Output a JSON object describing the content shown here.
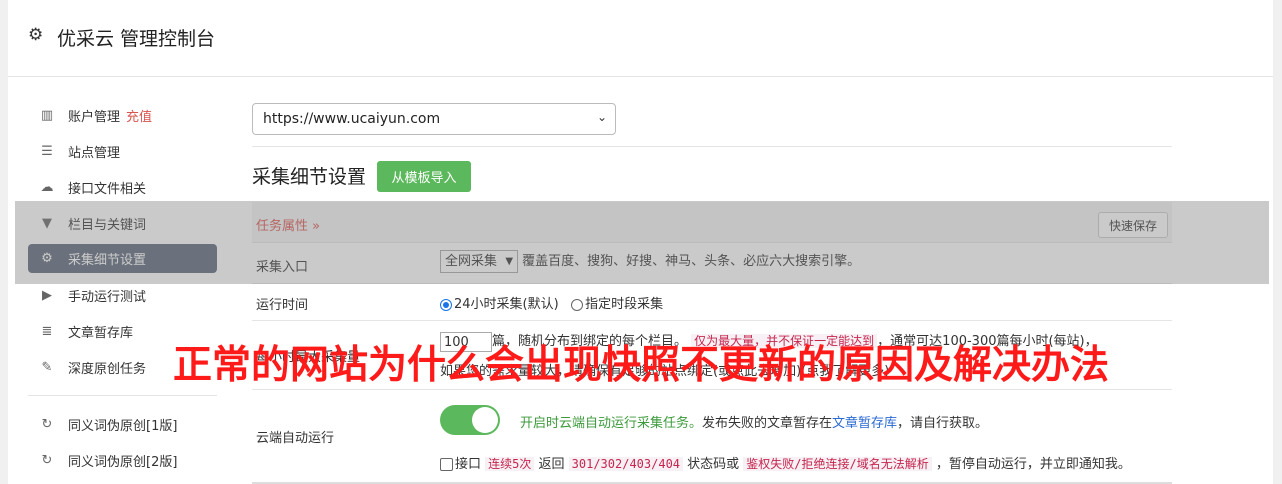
{
  "header": {
    "icon": "gear-icon",
    "title": "优采云 管理控制台"
  },
  "sidebar": {
    "items": [
      {
        "icon": "bar-chart-icon",
        "glyph": "▥",
        "label": "账户管理",
        "extra": "充值"
      },
      {
        "icon": "server-icon",
        "glyph": "☰",
        "label": "站点管理"
      },
      {
        "icon": "cloud-upload-icon",
        "glyph": "☁",
        "label": "接口文件相关"
      },
      {
        "icon": "filter-icon",
        "glyph": "▼",
        "label": "栏目与关键词"
      },
      {
        "icon": "cogs-icon",
        "glyph": "⚙",
        "label": "采集细节设置"
      },
      {
        "icon": "play-circle-icon",
        "glyph": "▶",
        "label": "手动运行测试"
      },
      {
        "icon": "database-icon",
        "glyph": "≣",
        "label": "文章暂存库"
      },
      {
        "icon": "edit-icon",
        "glyph": "✎",
        "label": "深度原创任务"
      },
      {
        "icon": "refresh-icon",
        "glyph": "↻",
        "label": "同义词伪原创[1版]"
      },
      {
        "icon": "refresh-icon",
        "glyph": "↻",
        "label": "同义词伪原创[2版]"
      }
    ],
    "active_item": "采集细节设置"
  },
  "main": {
    "site_select": {
      "value": "https://www.ucaiyun.com"
    },
    "section_title": "采集细节设置",
    "import_button": "从模板导入",
    "task_header": {
      "label": "任务属性 »",
      "save_button": "快速保存"
    },
    "rows": {
      "entry": {
        "label": "采集入口",
        "select_value": "全网采集",
        "desc": "覆盖百度、搜狗、好搜、神马、头条、必应六大搜索引擎。"
      },
      "runtime": {
        "label": "运行时间",
        "opt1": "24小时采集(默认)",
        "opt2": "指定时段采集"
      },
      "volume": {
        "label": "每小时最大采集量",
        "input_value": "100",
        "t1": "篇，随机分布到绑定的每个栏目。",
        "highlight": "仅为最大量，并不保证一定能达到",
        "t2": "，通常可达100-300篇每小时(每站)，",
        "line2": "如果您的需求量较大，请确保有足够的站点绑定(或点此去增加)(点我了解更多)",
        "line2_link": "点我了解更多"
      },
      "cloud": {
        "label": "云端自动运行",
        "toggle_text": "开启时云端自动运行采集任务。",
        "t2": "发布失败的文章暂存在",
        "link": "文章暂存库",
        "t3": "，请自行获取。",
        "chk1": "接口",
        "code1": "连续5次",
        "chk2": " 返回 ",
        "code2": "301/302/403/404",
        "chk3": " 状态码或 ",
        "code3": "鉴权失败/拒绝连接/域名无法解析",
        "chk4": " ，暂停自动运行，并立即通知我。"
      }
    }
  },
  "overlay_banner": "正常的网站为什么会出现快照不更新的原因及解决办法",
  "colors": {
    "accent_green": "#5cb85c",
    "active_nav": "#5b6779",
    "banner_red": "#ff1a1a",
    "danger": "#d9534f"
  }
}
